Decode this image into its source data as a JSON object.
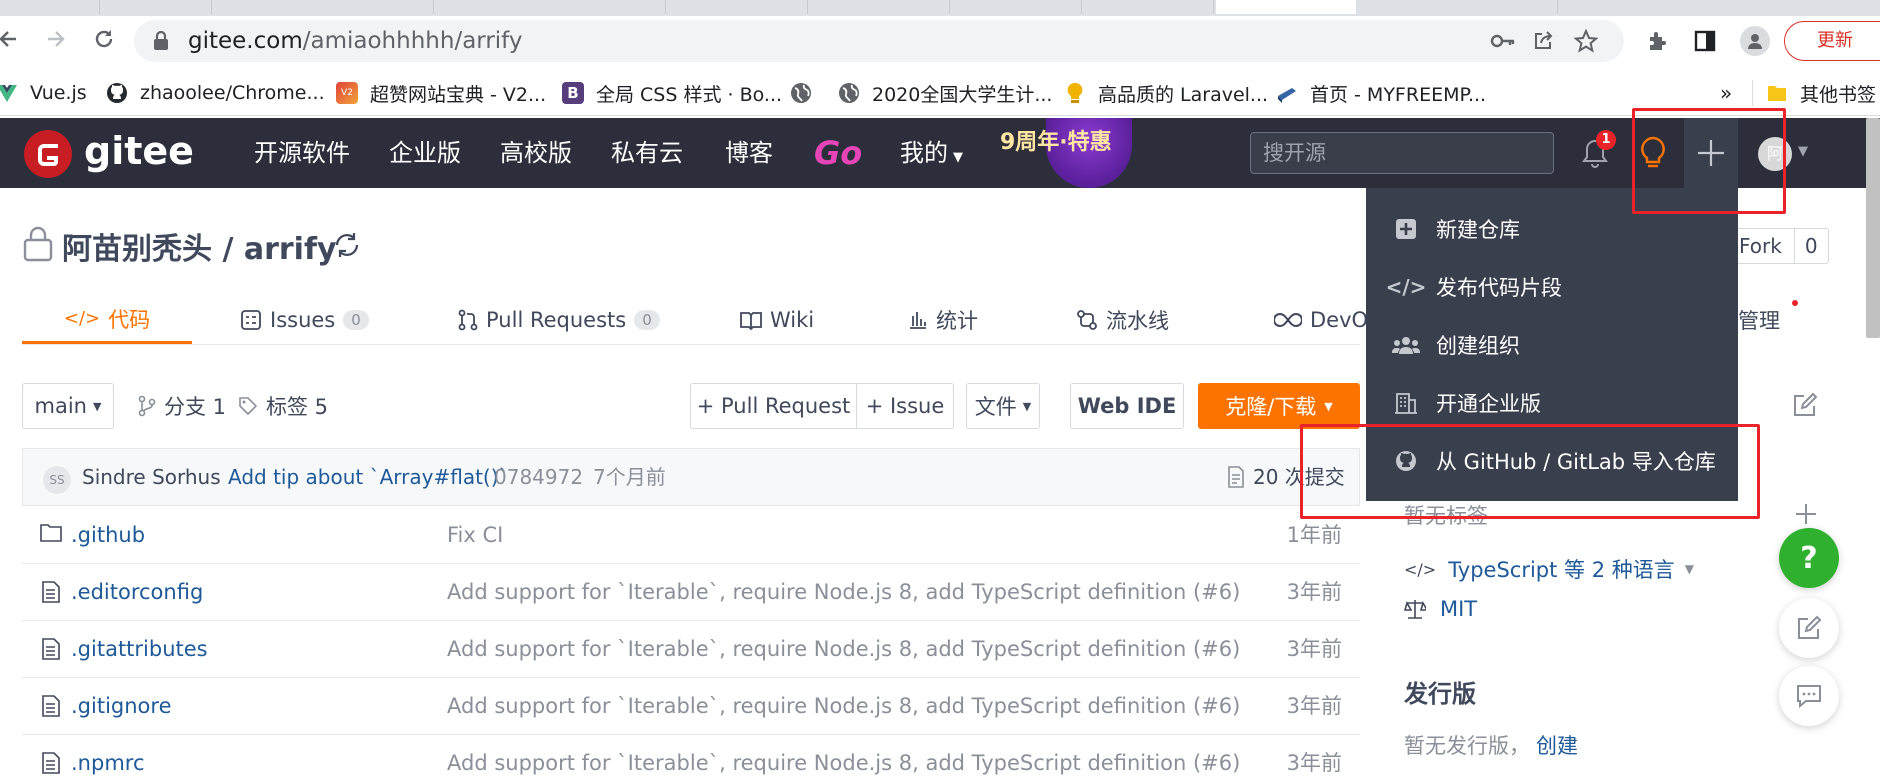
{
  "browser": {
    "url_host": "gitee.com",
    "url_path": "/amiaohhhhh/arrify",
    "update_button": "更新",
    "bookmarks": [
      {
        "label": "Vue.js",
        "icon": "vue-icon",
        "color": "#41b883"
      },
      {
        "label": "zhaoolee/Chrome...",
        "icon": "github-icon",
        "color": "#24292e"
      },
      {
        "label": "超赞网站宝典 - V2...",
        "icon": "v2-icon",
        "color": "#e0443a"
      },
      {
        "label": "全局 CSS 样式 · Bo...",
        "icon": "bootstrap-icon",
        "color": "#563d7c"
      },
      {
        "label": "",
        "icon": "globe-icon",
        "color": "#5f6368"
      },
      {
        "label": "2020全国大学生计...",
        "icon": "globe-icon",
        "color": "#5f6368"
      },
      {
        "label": "高品质的 Laravel...",
        "icon": "bulb-icon",
        "color": "#f0b400"
      },
      {
        "label": "首页 - MYFREEMP...",
        "icon": "book-icon",
        "color": "#3465a4"
      }
    ],
    "more_label": "»",
    "other_bookmarks": "其他书签"
  },
  "gitee": {
    "logo_text": "gitee",
    "nav": [
      "开源软件",
      "企业版",
      "高校版",
      "私有云",
      "博客",
      "Go",
      "我的"
    ],
    "promo": "9周年·特惠",
    "search_placeholder": "搜开源",
    "notification_count": "1",
    "avatar_text": "阿"
  },
  "repo": {
    "title": "阿苗别秃头 / arrify",
    "fork_label": "Fork",
    "fork_count": "0",
    "tabs": [
      {
        "label": "代码",
        "badge": ""
      },
      {
        "label": "Issues",
        "badge": "0"
      },
      {
        "label": "Pull Requests",
        "badge": "0"
      },
      {
        "label": "Wiki",
        "badge": ""
      },
      {
        "label": "统计",
        "badge": ""
      },
      {
        "label": "流水线",
        "badge": ""
      },
      {
        "label": "DevO",
        "badge": ""
      },
      {
        "label": "管理",
        "badge": ""
      }
    ],
    "branch": "main",
    "branches": "分支 1",
    "tags": "标签 5",
    "btn_pr": "+ Pull Request",
    "btn_issue": "+ Issue",
    "btn_files": "文件",
    "btn_webide": "Web IDE",
    "btn_clone": "克隆/下载",
    "commit": {
      "avatar": "SS",
      "author": "Sindre Sorhus",
      "message": "Add tip about `Array#flat()`",
      "hash": "0784972",
      "time": "7个月前",
      "count": "20 次提交"
    },
    "files": [
      {
        "name": ".github",
        "type": "folder",
        "message": "Fix CI",
        "time": "1年前"
      },
      {
        "name": ".editorconfig",
        "type": "file",
        "message": "Add support for `Iterable`, require Node.js 8, add TypeScript definition (#6)",
        "time": "3年前"
      },
      {
        "name": ".gitattributes",
        "type": "file",
        "message": "Add support for `Iterable`, require Node.js 8, add TypeScript definition (#6)",
        "time": "3年前"
      },
      {
        "name": ".gitignore",
        "type": "file",
        "message": "Add support for `Iterable`, require Node.js 8, add TypeScript definition (#6)",
        "time": "3年前"
      },
      {
        "name": ".npmrc",
        "type": "file",
        "message": "Add support for `Iterable`, require Node.js 8, add TypeScript definition (#6)",
        "time": "3年前"
      }
    ]
  },
  "dropdown": {
    "items": [
      {
        "label": "新建仓库",
        "icon": "plus-square-icon"
      },
      {
        "label": "发布代码片段",
        "icon": "code-icon"
      },
      {
        "label": "创建组织",
        "icon": "users-icon"
      },
      {
        "label": "开通企业版",
        "icon": "building-icon"
      },
      {
        "label": "从 GitHub / GitLab 导入仓库",
        "icon": "github-icon"
      }
    ]
  },
  "sidebar": {
    "no_tags": "暂无标签",
    "language": "TypeScript 等 2 种语言",
    "license": "MIT",
    "releases_title": "发行版",
    "no_releases": "暂无发行版，",
    "create_link": "创建"
  },
  "colors": {
    "header_bg": "#2c2f3b",
    "accent_orange": "#fe7300",
    "link_blue": "#1e5a99",
    "highlight_red": "#e8242a",
    "help_green": "#2fb12f"
  }
}
